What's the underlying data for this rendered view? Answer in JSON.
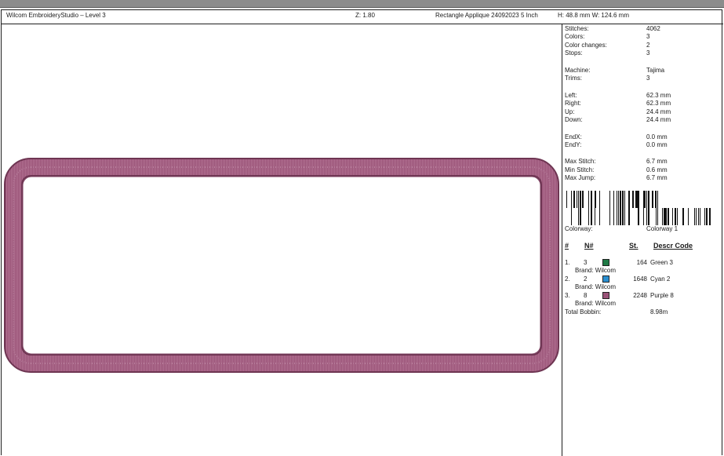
{
  "header": {
    "app_title": "Wilcom EmbroideryStudio – Level 3",
    "zoom": "Z: 1.80",
    "design_name": "Rectangle Applique 24092023 5 Inch",
    "dimensions": "H: 48.8 mm   W: 124.6 mm"
  },
  "stats": [
    {
      "label": "Stitches:",
      "value": "4062"
    },
    {
      "label": "Colors:",
      "value": "3"
    },
    {
      "label": "Color changes:",
      "value": "2"
    },
    {
      "label": "Stops:",
      "value": "3"
    },
    {
      "label": "Machine:",
      "value": "Tajima"
    },
    {
      "label": "Trims:",
      "value": "3"
    },
    {
      "label": "Left:",
      "value": "62.3 mm"
    },
    {
      "label": "Right:",
      "value": "62.3 mm"
    },
    {
      "label": "Up:",
      "value": "24.4 mm"
    },
    {
      "label": "Down:",
      "value": "24.4 mm"
    },
    {
      "label": "EndX:",
      "value": "0.0 mm"
    },
    {
      "label": "EndY:",
      "value": "0.0 mm"
    },
    {
      "label": "Max Stitch:",
      "value": "6.7 mm"
    },
    {
      "label": "Min Stitch:",
      "value": "0.6 mm"
    },
    {
      "label": "Max Jump:",
      "value": "6.7 mm"
    }
  ],
  "colorway": {
    "label": "Colorway:",
    "value": "Colorway 1"
  },
  "table": {
    "headers": {
      "num": "#",
      "n": "N#",
      "st": "St.",
      "descr": "Descr  Code"
    },
    "rows": [
      {
        "index": "1.",
        "n": "3",
        "swatch": "#1e7a45",
        "st": "164",
        "descr": "Green 3",
        "brand": "Brand: Wilcom"
      },
      {
        "index": "2.",
        "n": "2",
        "swatch": "#2b8fd0",
        "st": "1648",
        "descr": "Cyan 2",
        "brand": "Brand: Wilcom"
      },
      {
        "index": "3.",
        "n": "8",
        "swatch": "#9a5378",
        "st": "2248",
        "descr": "Purple 8",
        "brand": "Brand: Wilcom"
      }
    ],
    "total_bobbin_label": "Total Bobbin:",
    "total_bobbin_value": "8.98m"
  },
  "colors": {
    "frame_stitch": "#9a5378",
    "frame_stitch_dark": "#7a3d5e",
    "frame_stitch_light": "#b97a9b"
  }
}
